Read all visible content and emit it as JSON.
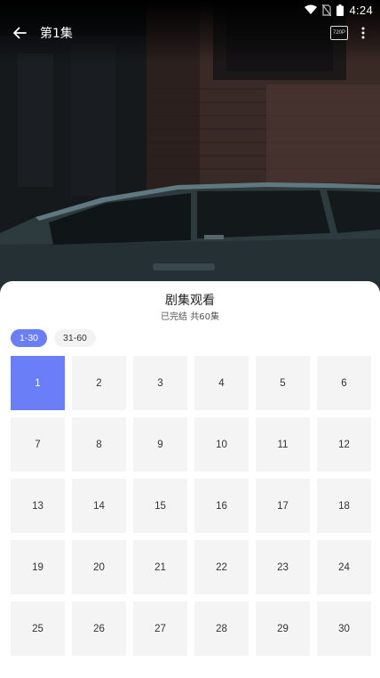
{
  "status_bar": {
    "time": "4:24",
    "icons": [
      "wifi-icon",
      "no-sim-icon",
      "battery-icon"
    ]
  },
  "player": {
    "episode_title": "第1集",
    "quality_label": "720P",
    "icons": [
      "back-arrow-icon",
      "more-vertical-icon"
    ]
  },
  "sheet": {
    "title": "剧集观看",
    "subtitle": "已完结 共60集",
    "range_tabs": [
      {
        "label": "1-30",
        "active": true
      },
      {
        "label": "31-60",
        "active": false
      }
    ],
    "current_episode": "1",
    "episodes": [
      "1",
      "2",
      "3",
      "4",
      "5",
      "6",
      "7",
      "8",
      "9",
      "10",
      "11",
      "12",
      "13",
      "14",
      "15",
      "16",
      "17",
      "18",
      "19",
      "20",
      "21",
      "22",
      "23",
      "24",
      "25",
      "26",
      "27",
      "28",
      "29",
      "30"
    ]
  },
  "colors": {
    "accent": "#6a7ef7",
    "tile_bg": "#f4f4f4",
    "tile_text": "#333333"
  }
}
